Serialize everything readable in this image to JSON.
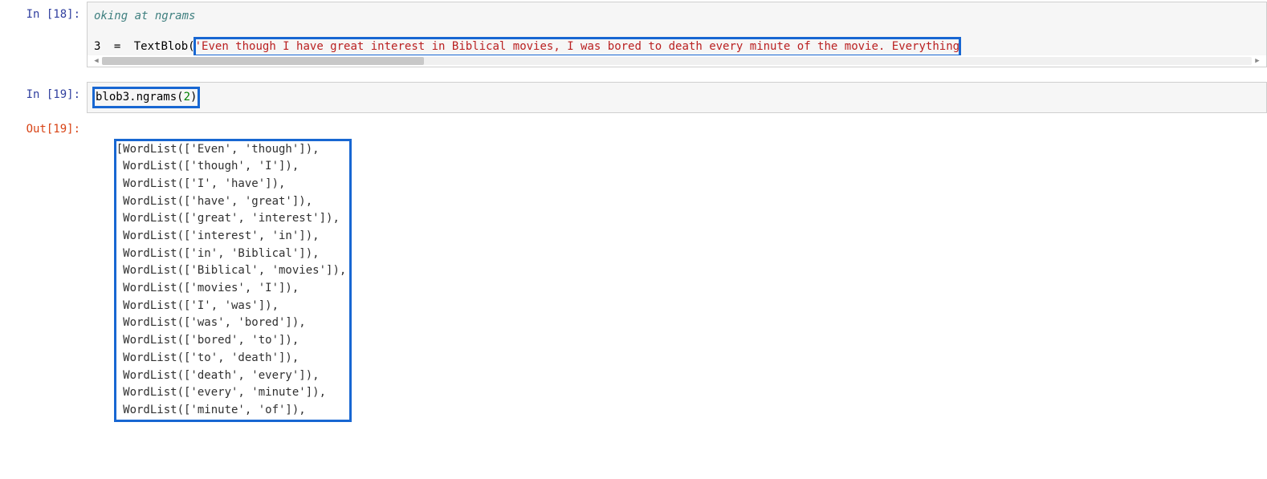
{
  "cell18": {
    "prompt": "In [18]:",
    "comment_fragment": "oking at ngrams",
    "assign_left": "3",
    "assign_op": " = ",
    "assign_textblob": "TextBlob",
    "string_fragment": "'Even though I have great interest in Biblical movies, I was bored to death every minute of the movie. Everything"
  },
  "cell19in": {
    "prompt": "In [19]:",
    "code_pre": "blob3.ngrams(",
    "code_num": "2",
    "code_post": ")"
  },
  "cell19out": {
    "prompt": "Out[19]:",
    "lines": [
      "[WordList(['Even', 'though']),",
      " WordList(['though', 'I']),",
      " WordList(['I', 'have']),",
      " WordList(['have', 'great']),",
      " WordList(['great', 'interest']),",
      " WordList(['interest', 'in']),",
      " WordList(['in', 'Biblical']),",
      " WordList(['Biblical', 'movies']),",
      " WordList(['movies', 'I']),",
      " WordList(['I', 'was']),",
      " WordList(['was', 'bored']),",
      " WordList(['bored', 'to']),",
      " WordList(['to', 'death']),",
      " WordList(['death', 'every']),",
      " WordList(['every', 'minute']),",
      " WordList(['minute', 'of']),"
    ]
  }
}
